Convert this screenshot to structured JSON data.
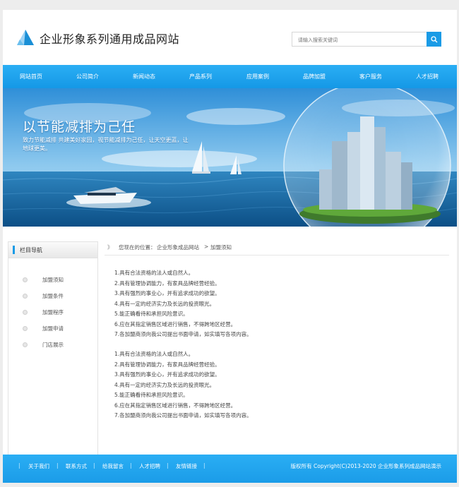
{
  "header": {
    "site_title": "企业形象系列通用成品网站",
    "search_placeholder": "请输入搜索关键词"
  },
  "nav": {
    "items": [
      "网站首页",
      "公司简介",
      "新闻动态",
      "产品系列",
      "应用案例",
      "品牌加盟",
      "客户服务",
      "人才招聘"
    ]
  },
  "banner": {
    "headline": "以节能减排为己任",
    "subline": "致力节能减排 共建美好家园，视节能减排为己任，让天空更蓝，让地球更美。"
  },
  "sidebar": {
    "title": "栏目导航",
    "items": [
      "加盟须知",
      "加盟条件",
      "加盟程序",
      "加盟申请",
      "门店展示"
    ]
  },
  "breadcrumb": {
    "arrows": "》",
    "prefix": "您现在的位置：",
    "site": "企业形象成品网站",
    "separator": ">",
    "current": "加盟须知"
  },
  "content": {
    "block1": [
      "1.具有合法资格的法人或自然人。",
      "2.具有管理协调能力，有家具品牌经营经验。",
      "3.具有强烈的事业心，并有追求成功的欲望。",
      "4.具有一定的经济实力及长远的投资眼光。",
      "5.能正确看待和承担风险意识。",
      "6.应在其指定销售区域进行销售，不得跨地区经营。",
      "7.各加盟商须向我公司提出书面申请，如实填写各项内容。"
    ],
    "block2": [
      "1.具有合法资格的法人或自然人。",
      "2.具有管理协调能力，有家具品牌经营经验。",
      "3.具有强烈的事业心，并有追求成功的欲望。",
      "4.具有一定的经济实力及长远的投资眼光。",
      "5.能正确看待和承担风险意识。",
      "6.应在其指定销售区域进行销售，不得跨地区经营。",
      "7.各加盟商须向我公司提出书面申请，如实填写各项内容。"
    ]
  },
  "footer": {
    "links": [
      "关于我们",
      "联系方式",
      "给我留言",
      "人才招聘",
      "友情链接"
    ],
    "separator": "|",
    "copyright": "版权所有  Copyright(C)2013-2020 企业形象系列成品网站演示"
  },
  "colors": {
    "accent": "#1a9be6",
    "nav_top": "#2aaef4",
    "nav_bottom": "#1598e6"
  },
  "icons": {
    "logo": "triangle-logo-icon",
    "search": "search-icon",
    "bullet": "circle-bullet-icon"
  }
}
